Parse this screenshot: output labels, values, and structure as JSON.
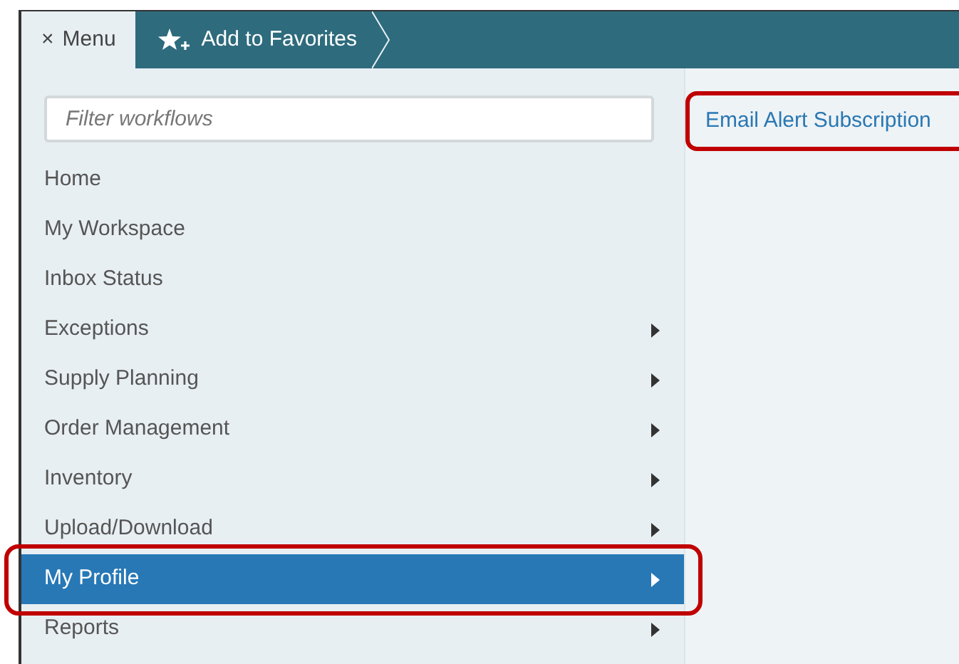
{
  "tabs": [
    {
      "label": "Menu",
      "icon": "×",
      "selected": true
    },
    {
      "label": "Add to Favorites",
      "selected": false
    }
  ],
  "filter": {
    "placeholder": "Filter workflows"
  },
  "menu_items": [
    {
      "label": "Home",
      "has_submenu": false,
      "selected": false
    },
    {
      "label": "My Workspace",
      "has_submenu": false,
      "selected": false
    },
    {
      "label": "Inbox Status",
      "has_submenu": false,
      "selected": false
    },
    {
      "label": "Exceptions",
      "has_submenu": true,
      "selected": false
    },
    {
      "label": "Supply Planning",
      "has_submenu": true,
      "selected": false
    },
    {
      "label": "Order Management",
      "has_submenu": true,
      "selected": false
    },
    {
      "label": "Inventory",
      "has_submenu": true,
      "selected": false
    },
    {
      "label": "Upload/Download",
      "has_submenu": true,
      "selected": false
    },
    {
      "label": "My Profile",
      "has_submenu": true,
      "selected": true
    },
    {
      "label": "Reports",
      "has_submenu": true,
      "selected": false
    }
  ],
  "submenu_items": [
    {
      "label": "Email Alert Subscription"
    }
  ]
}
